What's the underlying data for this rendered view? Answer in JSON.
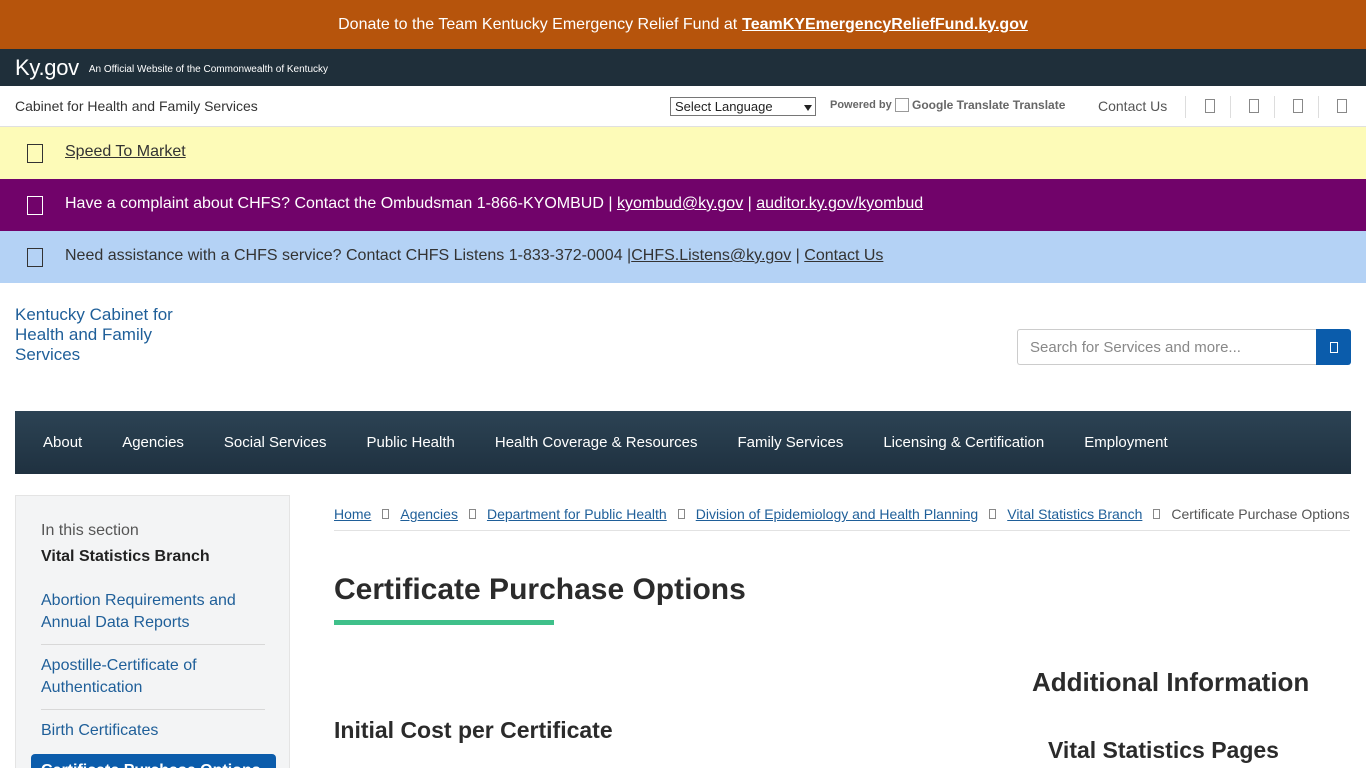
{
  "donate": {
    "text": "Donate to the Team Kentucky Emergency Relief Fund at",
    "link": "TeamKYEmergencyReliefFund.ky.gov"
  },
  "kygov": {
    "brand": "Ky.gov",
    "official": "An Official Website of the Commonwealth of Kentucky"
  },
  "utility": {
    "cabinet": "Cabinet for Health and Family Services",
    "language_select": "Select Language",
    "powered_by": "Powered by",
    "translate": "Google Translate Translate",
    "contact": "Contact Us"
  },
  "alerts": {
    "speed": "Speed To Market",
    "ombudsman_text": "Have a complaint about CHFS? Contact the Ombudsman 1-866-KYOMBUD |",
    "ombudsman_email": "kyombud@ky.gov",
    "ombudsman_sep": "|",
    "ombudsman_url": "auditor.ky.gov/kyombud",
    "listens_text": "Need assistance with a CHFS service? Contact CHFS Listens 1-833-372-0004 |",
    "listens_email": "CHFS.Listens@ky.gov",
    "listens_sep": "|",
    "listens_contact": "Contact Us "
  },
  "header": {
    "logo_alt": "Kentucky Cabinet for Health and Family Services",
    "search_placeholder": "Search for Services and more..."
  },
  "nav": {
    "items": [
      "About",
      "Agencies",
      "Social Services",
      "Public Health",
      "Health Coverage & Resources",
      "Family Services",
      "Licensing & Certification",
      "Employment"
    ]
  },
  "sidebar": {
    "in_section": "In this section",
    "section_title": "Vital Statistics Branch",
    "links": [
      "Abortion Requirements and Annual Data Reports",
      "Apostille-Certificate of Authentication",
      "Birth Certificates"
    ],
    "active": "Certificate Purchase Options"
  },
  "breadcrumb": {
    "items": [
      "Home",
      "Agencies",
      "Department for Public Health",
      "Division of Epidemiology and Health Planning",
      "Vital Statistics Branch"
    ],
    "current": "Certificate Purchase Options"
  },
  "main": {
    "title": "Certificate Purchase Options",
    "h_initial": "Initial Cost per Certificate",
    "h_additional": "Additional Information",
    "h_vital": "Vital Statistics Pages"
  },
  "colors": {
    "donate_bg": "#b6540c",
    "kygov_bg": "#1f2f3a",
    "alert_yellow": "#fdfbb8",
    "alert_purple": "#71036a",
    "alert_blue": "#b4d2f5",
    "nav_bg": "#1f3140",
    "link": "#1f5f99",
    "accent": "#0b5cab",
    "title_underline": "#3fc08a"
  }
}
